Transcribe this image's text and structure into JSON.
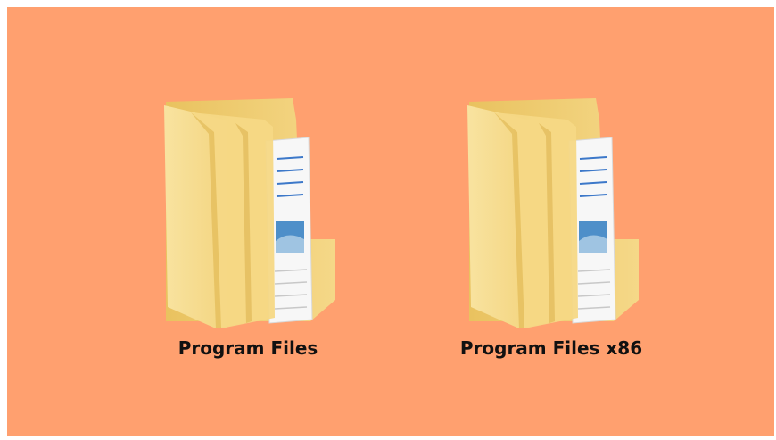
{
  "desktop": {
    "background_color": "#ffa06f",
    "folders": [
      {
        "label": "Program Files",
        "icon": "folder-with-documents-icon"
      },
      {
        "label": "Program Files x86",
        "icon": "folder-with-documents-icon"
      }
    ]
  }
}
